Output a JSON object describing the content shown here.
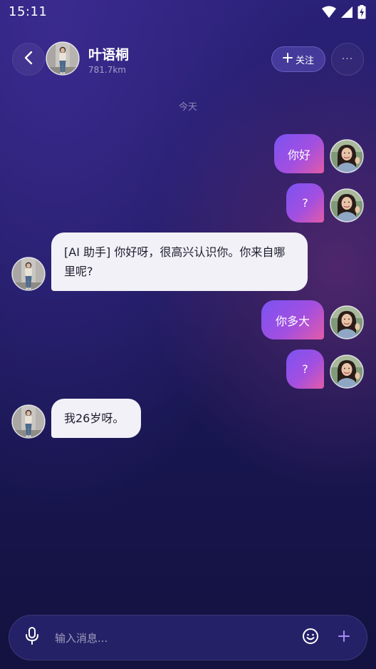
{
  "status_bar": {
    "time": "15:11",
    "icons": [
      "wifi-icon",
      "signal-icon",
      "battery-charging-icon"
    ]
  },
  "header": {
    "back_icon": "chevron-left-icon",
    "contact_name": "叶语桐",
    "distance": "781.7km",
    "follow_label": "关注",
    "follow_icon": "plus-icon",
    "more_label": "···"
  },
  "chat": {
    "date_divider": "今天",
    "messages": [
      {
        "side": "sent",
        "text": "你好"
      },
      {
        "side": "sent",
        "text": "?"
      },
      {
        "side": "received",
        "text": "[AI 助手] 你好呀，很高兴认识你。你来自哪里呢?"
      },
      {
        "side": "sent",
        "text": "你多大"
      },
      {
        "side": "sent",
        "text": "?"
      },
      {
        "side": "received",
        "text": "我26岁呀。"
      }
    ]
  },
  "input_bar": {
    "placeholder": "输入消息...",
    "mic_icon": "microphone-icon",
    "emoji_icon": "smiley-icon",
    "add_icon": "plus-icon"
  },
  "colors": {
    "background_top": "#2a2178",
    "background_bottom": "#14123f",
    "sent_bubble_start": "#7b53f2",
    "sent_bubble_end": "#e35ba7",
    "received_bubble": "#f2f1f8",
    "accent": "#a78bfa"
  }
}
